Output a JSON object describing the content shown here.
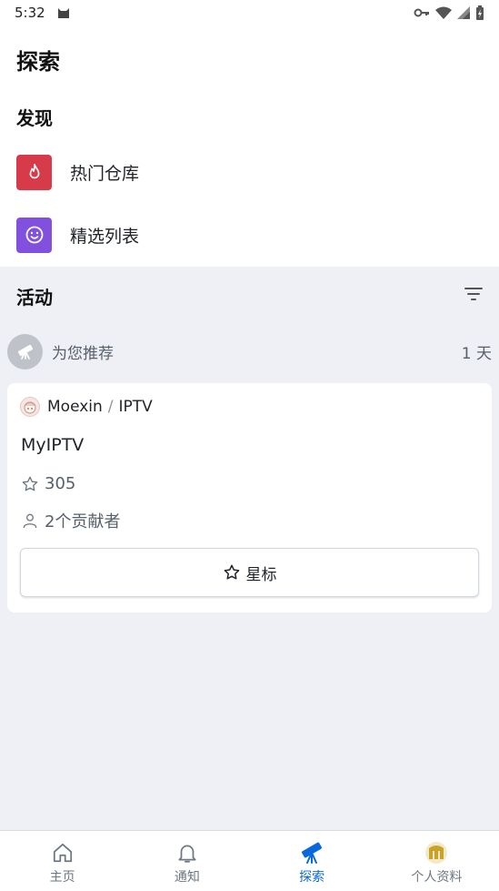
{
  "status_bar": {
    "time": "5:32"
  },
  "page": {
    "title": "探索"
  },
  "discover": {
    "title": "发现",
    "items": [
      {
        "label": "热门仓库",
        "icon": "flame-icon",
        "color": "#d73a49"
      },
      {
        "label": "精选列表",
        "icon": "smiley-icon",
        "color": "#8250df"
      }
    ]
  },
  "activity": {
    "title": "活动",
    "recommend_label": "为您推荐",
    "recommend_time": "1 天",
    "card": {
      "owner": "Moexin",
      "separator": "/",
      "repo": "IPTV",
      "description": "MyIPTV",
      "stars": "305",
      "contributors": "2个贡献者",
      "star_button": "星标"
    }
  },
  "bottom_nav": {
    "items": [
      {
        "label": "主页",
        "icon": "home-icon",
        "active": false
      },
      {
        "label": "通知",
        "icon": "bell-icon",
        "active": false
      },
      {
        "label": "探索",
        "icon": "telescope-icon",
        "active": true
      },
      {
        "label": "个人资料",
        "icon": "profile-avatar-icon",
        "active": false
      }
    ]
  },
  "colors": {
    "accent": "#0969da",
    "background": "#eef0f5"
  }
}
